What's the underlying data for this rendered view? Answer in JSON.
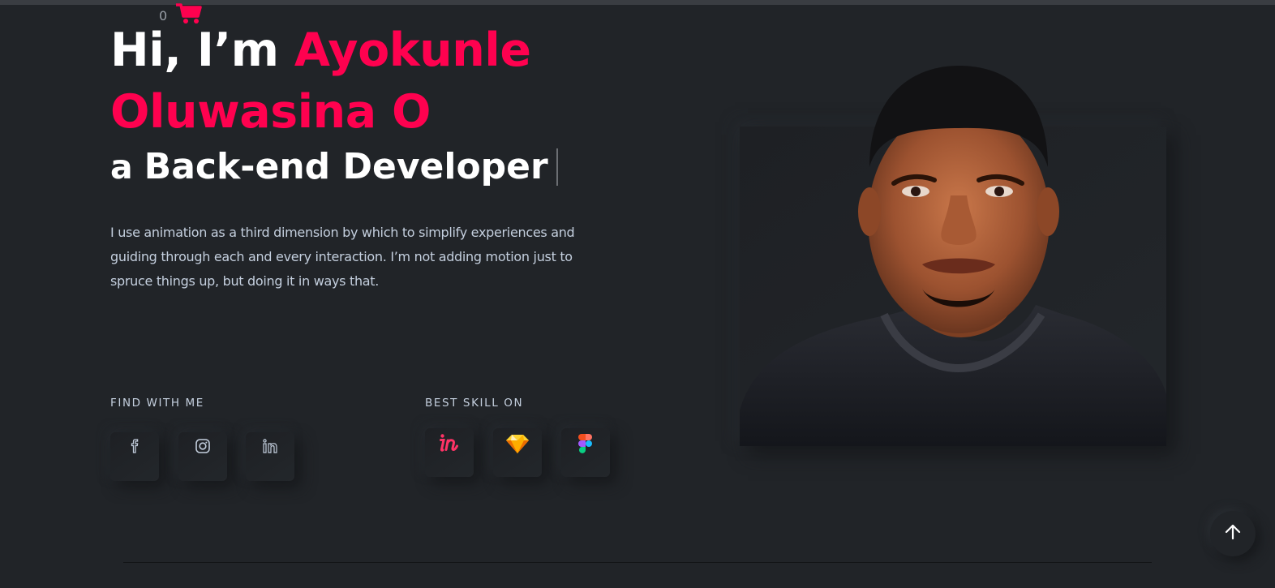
{
  "cart": {
    "count": "0",
    "icon": "cart-icon"
  },
  "hero": {
    "greeting": "Hi, I’m ",
    "name_line1": "Ayokunle",
    "name_line2": "Oluwasina O",
    "role_prefix": "a",
    "role": "Back-end Developer",
    "intro": "I use animation as a third dimension by which to simplify experiences and guiding through each and every interaction. I’m not adding motion just to spruce things up, but doing it in ways that."
  },
  "social": {
    "label": "FIND WITH ME",
    "items": [
      {
        "icon": "facebook-icon"
      },
      {
        "icon": "instagram-icon"
      },
      {
        "icon": "linkedin-icon"
      }
    ]
  },
  "skills": {
    "label": "BEST SKILL ON",
    "items": [
      {
        "icon": "invision-icon"
      },
      {
        "icon": "sketch-icon"
      },
      {
        "icon": "figma-icon"
      }
    ]
  },
  "colors": {
    "accent": "#ff014f",
    "background": "#212428",
    "text": "#c4cfde"
  },
  "back_to_top": {
    "icon": "arrow-up-icon"
  }
}
